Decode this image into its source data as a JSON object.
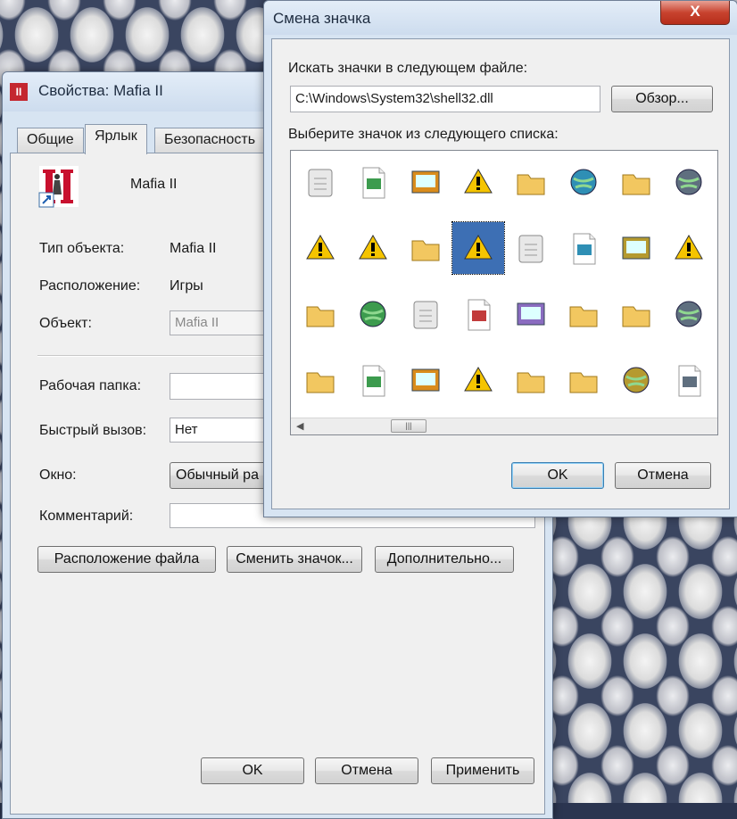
{
  "properties_window": {
    "title": "Свойства: Mafia II",
    "app_icon_text": "II",
    "tabs": [
      {
        "label": "Общие"
      },
      {
        "label": "Ярлык"
      },
      {
        "label": "Безопасность"
      }
    ],
    "shortcut_name": "Mafia II",
    "fields": {
      "type_label": "Тип объекта:",
      "type_value": "Mafia II",
      "location_label": "Расположение:",
      "location_value": "Игры",
      "target_label": "Объект:",
      "target_value": "Mafia II",
      "workdir_label": "Рабочая папка:",
      "workdir_value": "",
      "hotkey_label": "Быстрый вызов:",
      "hotkey_value": "Нет",
      "window_label": "Окно:",
      "window_value": "Обычный ра",
      "comment_label": "Комментарий:"
    },
    "buttons": {
      "file_location": "Расположение файла",
      "change_icon": "Сменить значок...",
      "advanced": "Дополнительно...",
      "ok": "OK",
      "cancel": "Отмена",
      "apply": "Применить"
    }
  },
  "change_icon_dialog": {
    "title": "Смена значка",
    "close_glyph": "X",
    "search_label": "Искать значки в следующем файле:",
    "file_path": "C:\\Windows\\System32\\shell32.dll",
    "browse_button": "Обзор...",
    "list_label": "Выберите значок из следующего списка:",
    "scrollbar_left": "◀",
    "scrollbar_thumb": "|||",
    "ok_button": "OK",
    "cancel_button": "Отмена",
    "icons": [
      "recycle-bin-icon",
      "file-move-icon",
      "settings-file-icon",
      "drive-icon",
      "cubes-icon",
      "tree-diagram-icon",
      "network-folder-icon",
      "network-computer-icon",
      "file-warning-icon",
      "gear-document-icon",
      "font-a-icon",
      "warning-icon",
      "printer-check-icon",
      "network-place-icon",
      "image-document-icon",
      "monitor-window-icon",
      "folder-warning-icon",
      "text-document-icon",
      "font-tt-icon",
      "cd-drive-icon",
      "network-printer-icon",
      "favorites-folder-icon",
      "control-panel-icon",
      "screensaver-monitor-icon",
      "open-folder-icon",
      "gear-image-icon",
      "font-a-italic-icon",
      "removable-drive-icon",
      "printer-cart-icon",
      "folder-list-icon",
      "globe-icon",
      "spreadsheet-icon"
    ],
    "selected_icon_index": 11
  }
}
